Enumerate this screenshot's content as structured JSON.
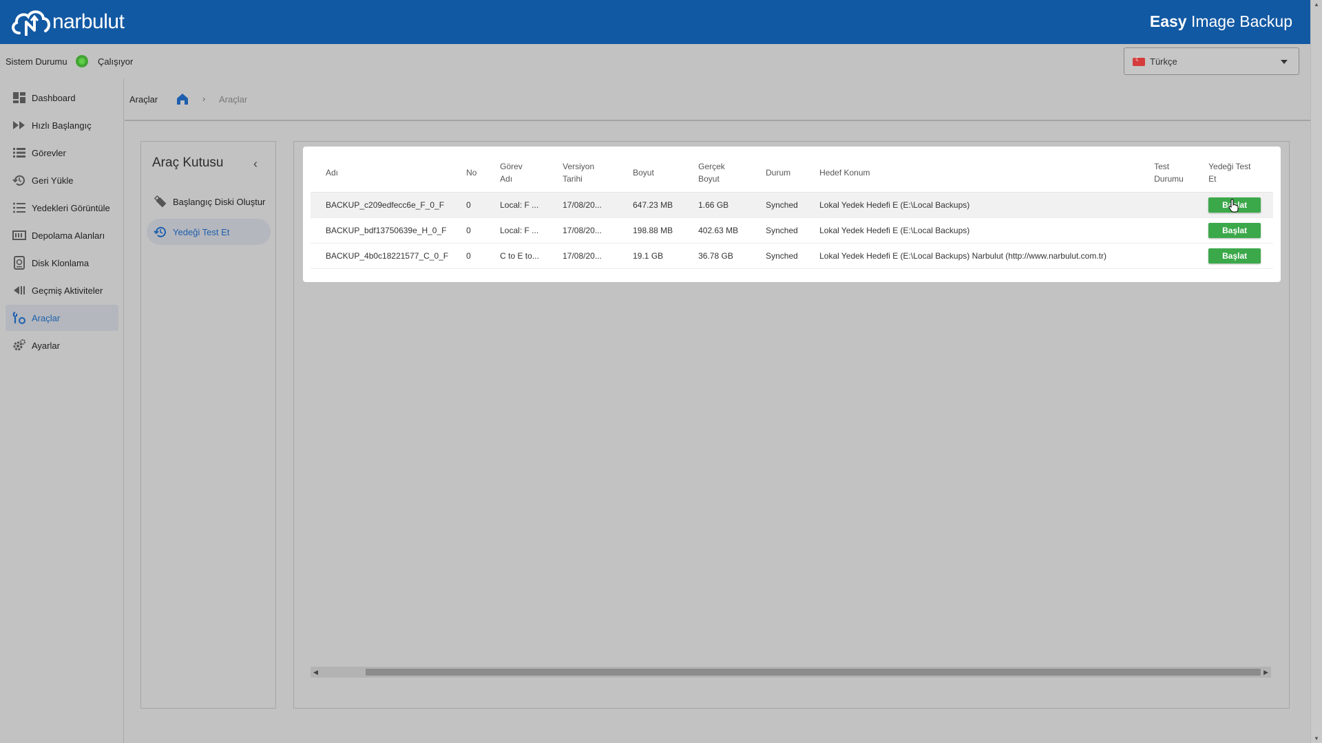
{
  "header": {
    "brand": "narbulut",
    "product_bold": "Easy",
    "product_rest": " Image Backup"
  },
  "status": {
    "label": "Sistem Durumu",
    "value": "Çalışıyor",
    "indicator_color": "#4aa83b"
  },
  "language": {
    "selected": "Türkçe"
  },
  "nav": {
    "items": [
      {
        "label": "Dashboard",
        "icon": "dashboard-icon"
      },
      {
        "label": "Hızlı Başlangıç",
        "icon": "fast-forward-icon"
      },
      {
        "label": "Görevler",
        "icon": "task-list-icon"
      },
      {
        "label": "Geri Yükle",
        "icon": "restore-icon"
      },
      {
        "label": "Yedekleri Görüntüle",
        "icon": "list-icon"
      },
      {
        "label": "Depolama Alanları",
        "icon": "storage-icon"
      },
      {
        "label": "Disk Klonlama",
        "icon": "disk-clone-icon"
      },
      {
        "label": "Geçmiş Aktiviteler",
        "icon": "history-icon"
      },
      {
        "label": "Araçlar",
        "icon": "tools-icon",
        "active": true
      },
      {
        "label": "Ayarlar",
        "icon": "settings-icon"
      }
    ]
  },
  "breadcrumb": {
    "title": "Araçlar",
    "current": "Araçlar"
  },
  "toolbox": {
    "title": "Araç Kutusu",
    "items": [
      {
        "label": "Başlangıç Diski Oluştur",
        "icon": "usb-drive-icon"
      },
      {
        "label": "Yedeği Test Et",
        "icon": "restore-icon",
        "active": true
      }
    ]
  },
  "table": {
    "columns": {
      "name": "Adı",
      "no": "No",
      "task_line1": "Görev",
      "task_line2": "Adı",
      "version_line1": "Versiyon",
      "version_line2": "Tarihi",
      "size": "Boyut",
      "real_line1": "Gerçek",
      "real_line2": "Boyut",
      "state": "Durum",
      "target": "Hedef Konum",
      "test_line1": "Test",
      "test_line2": "Durumu",
      "action_line1": "Yedeği Test",
      "action_line2": "Et"
    },
    "rows": [
      {
        "name": "BACKUP_c209edfecc6e_F_0_F",
        "no": "0",
        "task": "Local: F ...",
        "version": "17/08/20...",
        "size": "647.23 MB",
        "real": "1.66 GB",
        "state": "Synched",
        "target": "Lokal Yedek Hedefi E (E:\\Local Backups)",
        "test": "",
        "action": "Başlat"
      },
      {
        "name": "BACKUP_bdf13750639e_H_0_F",
        "no": "0",
        "task": "Local: F ...",
        "version": "17/08/20...",
        "size": "198.88 MB",
        "real": "402.63 MB",
        "state": "Synched",
        "target": "Lokal Yedek Hedefi E (E:\\Local Backups)",
        "test": "",
        "action": "Başlat"
      },
      {
        "name": "BACKUP_4b0c18221577_C_0_F",
        "no": "0",
        "task": "C to E to...",
        "version": "17/08/20...",
        "size": "19.1 GB",
        "real": "36.78 GB",
        "state": "Synched",
        "target": "Lokal Yedek Hedefi E (E:\\Local Backups) Narbulut (http://www.narbulut.com.tr)",
        "test": "",
        "action": "Başlat"
      }
    ]
  },
  "colors": {
    "header_bg": "#1259a3",
    "accent": "#1d5fae",
    "button_green": "#3ba84a"
  }
}
